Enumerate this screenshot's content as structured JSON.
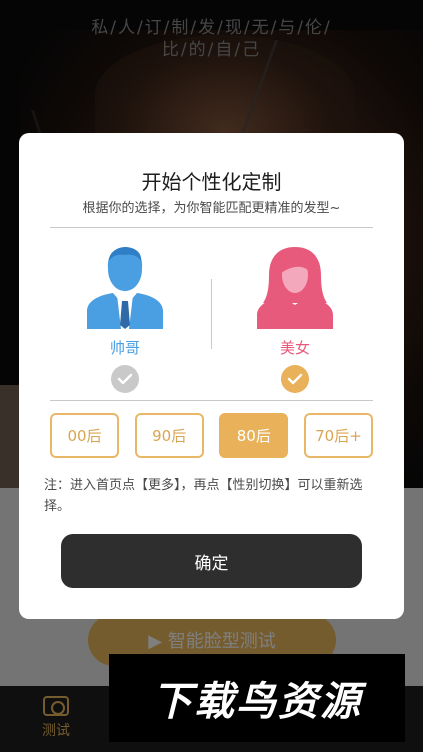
{
  "background": {
    "slogan_line1": "私/人/订/制/发/现/无/与/伦/",
    "slogan_line2": "比/的/自/己",
    "test_button_label": "▶ 智能脸型测试",
    "tab_label": "测试"
  },
  "dialog": {
    "title": "开始个性化定制",
    "subtitle": "根据你的选择，为你智能匹配更精准的发型~",
    "genders": [
      {
        "label": "帅哥",
        "selected": false,
        "color": "#4a9fe3",
        "icon": "male-avatar-icon"
      },
      {
        "label": "美女",
        "selected": true,
        "color": "#e85a7c",
        "icon": "female-avatar-icon"
      }
    ],
    "ages": [
      {
        "label": "00后",
        "selected": false
      },
      {
        "label": "90后",
        "selected": false
      },
      {
        "label": "80后",
        "selected": true
      },
      {
        "label": "70后+",
        "selected": false
      }
    ],
    "note": "注：进入首页点【更多】，再点【性别切换】可以重新选择。",
    "confirm_label": "确定"
  },
  "watermark_text": "下载鸟资源",
  "colors": {
    "accent": "#e8b15a",
    "male": "#4a9fe3",
    "female": "#e85a7c",
    "confirm_bg": "#2e2e2e"
  }
}
